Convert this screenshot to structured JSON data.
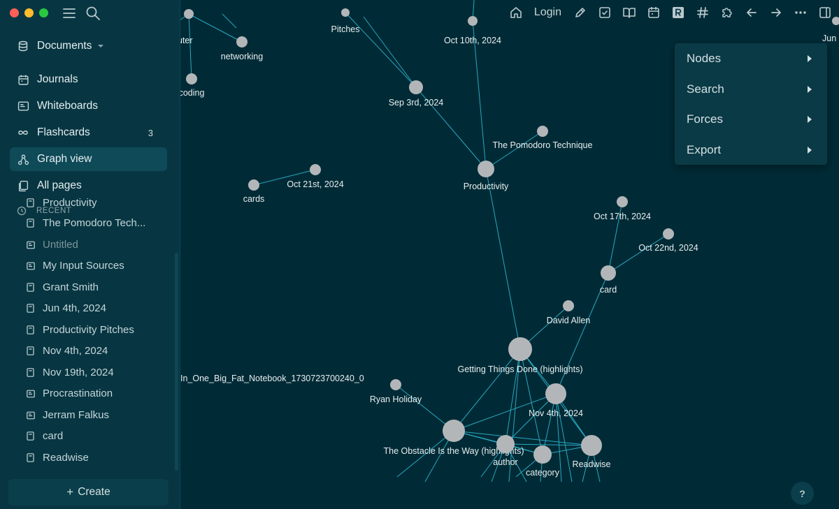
{
  "sidebar": {
    "documents_label": "Documents",
    "nav": [
      {
        "label": "Journals",
        "icon": "calendar-icon",
        "count": ""
      },
      {
        "label": "Whiteboards",
        "icon": "whiteboard-icon",
        "count": ""
      },
      {
        "label": "Flashcards",
        "icon": "infinity-icon",
        "count": "3"
      },
      {
        "label": "Graph view",
        "icon": "graph-icon",
        "count": "",
        "active": true
      },
      {
        "label": "All pages",
        "icon": "pages-icon",
        "count": ""
      }
    ],
    "recent_header": "RECENT",
    "recent": [
      {
        "label": "Productivity",
        "icon": "page-icon"
      },
      {
        "label": "The Pomodoro Tech...",
        "icon": "page-icon"
      },
      {
        "label": "Untitled",
        "icon": "whiteboard-icon",
        "dim": true
      },
      {
        "label": "My Input Sources",
        "icon": "whiteboard-icon"
      },
      {
        "label": "Grant Smith",
        "icon": "page-icon"
      },
      {
        "label": "Jun 4th, 2024",
        "icon": "page-icon"
      },
      {
        "label": "Productivity Pitches",
        "icon": "page-icon"
      },
      {
        "label": "Nov 4th, 2024",
        "icon": "page-icon"
      },
      {
        "label": "Nov 19th, 2024",
        "icon": "page-icon"
      },
      {
        "label": "Procrastination",
        "icon": "whiteboard-icon"
      },
      {
        "label": "Jerram Falkus",
        "icon": "whiteboard-icon"
      },
      {
        "label": "card",
        "icon": "page-icon"
      },
      {
        "label": "Readwise",
        "icon": "page-icon"
      }
    ],
    "create_label": "Create"
  },
  "toolbar": {
    "login_label": "Login",
    "icons": [
      "home-icon",
      "pencil-icon",
      "checkbox-icon",
      "book-icon",
      "calendar-icon",
      "readwise-icon",
      "hashtag-icon",
      "puzzle-icon",
      "arrow-left-icon",
      "arrow-right-icon",
      "more-icon",
      "sidebar-toggle-icon"
    ]
  },
  "menu": {
    "items": [
      {
        "label": "Nodes"
      },
      {
        "label": "Search"
      },
      {
        "label": "Forces"
      },
      {
        "label": "Export"
      }
    ]
  },
  "help_label": "?",
  "graph": {
    "node_color": "#b3b6b8",
    "edge_color": "#2aa7c0",
    "nodes": [
      {
        "id": "computer",
        "label": "uter"
      },
      {
        "id": "networking",
        "label": "networking"
      },
      {
        "id": "coding",
        "label": "coding"
      },
      {
        "id": "pitches",
        "label": "Pitches"
      },
      {
        "id": "oct10",
        "label": "Oct 10th, 2024"
      },
      {
        "id": "jun",
        "label": "Jun"
      },
      {
        "id": "sep3",
        "label": "Sep 3rd, 2024"
      },
      {
        "id": "pomodoro",
        "label": "The Pomodoro Technique"
      },
      {
        "id": "productivity",
        "label": "Productivity"
      },
      {
        "id": "oct21",
        "label": "Oct 21st, 2024"
      },
      {
        "id": "cards",
        "label": "cards"
      },
      {
        "id": "oct17",
        "label": "Oct 17th, 2024"
      },
      {
        "id": "oct22",
        "label": "Oct 22nd, 2024"
      },
      {
        "id": "card",
        "label": "card"
      },
      {
        "id": "davidallen",
        "label": "David Allen"
      },
      {
        "id": "gtd",
        "label": "Getting Things Done (highlights)"
      },
      {
        "id": "nov4",
        "label": "Nov 4th, 2024"
      },
      {
        "id": "notebook",
        "label": "In_One_Big_Fat_Notebook_1730723700240_0"
      },
      {
        "id": "ryan",
        "label": "Ryan Holiday"
      },
      {
        "id": "obstacle",
        "label": "The Obstacle Is the Way (highlights)"
      },
      {
        "id": "author",
        "label": "author"
      },
      {
        "id": "category",
        "label": "category"
      },
      {
        "id": "readwise",
        "label": "Readwise"
      }
    ],
    "edges": [
      [
        "computer",
        "networking"
      ],
      [
        "computer",
        "coding"
      ],
      [
        "pitches",
        "sep3"
      ],
      [
        "oct10",
        "productivity"
      ],
      [
        "sep3",
        "productivity"
      ],
      [
        "pomodoro",
        "productivity"
      ],
      [
        "productivity",
        "gtd"
      ],
      [
        "oct21",
        "cards"
      ],
      [
        "oct17",
        "card"
      ],
      [
        "oct22",
        "card"
      ],
      [
        "card",
        "nov4"
      ],
      [
        "davidallen",
        "gtd"
      ],
      [
        "gtd",
        "nov4"
      ],
      [
        "gtd",
        "obstacle"
      ],
      [
        "nov4",
        "obstacle"
      ],
      [
        "ryan",
        "obstacle"
      ],
      [
        "obstacle",
        "author"
      ],
      [
        "obstacle",
        "category"
      ],
      [
        "obstacle",
        "readwise"
      ],
      [
        "nov4",
        "author"
      ],
      [
        "nov4",
        "category"
      ],
      [
        "nov4",
        "readwise"
      ],
      [
        "gtd",
        "author"
      ],
      [
        "gtd",
        "category"
      ],
      [
        "gtd",
        "readwise"
      ],
      [
        "author",
        "category"
      ],
      [
        "author",
        "readwise"
      ],
      [
        "category",
        "readwise"
      ]
    ]
  }
}
